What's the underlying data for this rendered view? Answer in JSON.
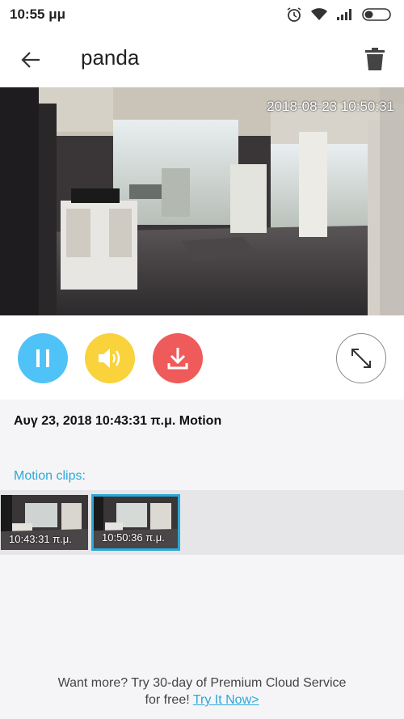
{
  "status_bar": {
    "time": "10:55 μμ"
  },
  "app_bar": {
    "title": "panda"
  },
  "video": {
    "timestamp": "2018-08-23 10:50:31"
  },
  "event": {
    "title": "Αυγ 23, 2018 10:43:31 π.μ.  Motion"
  },
  "clips": {
    "label": "Motion clips:",
    "items": [
      {
        "time": "10:43:31 π.μ.",
        "selected": false
      },
      {
        "time": "10:50:36 π.μ.",
        "selected": true
      }
    ]
  },
  "promo": {
    "line1": "Want more? Try 30-day of Premium Cloud Service",
    "line2_prefix": "for free! ",
    "link": "Try It Now>"
  },
  "colors": {
    "accent": "#2aa8d8",
    "pause": "#4fc3f7",
    "sound": "#f9d23c",
    "download": "#ef5b5b"
  }
}
